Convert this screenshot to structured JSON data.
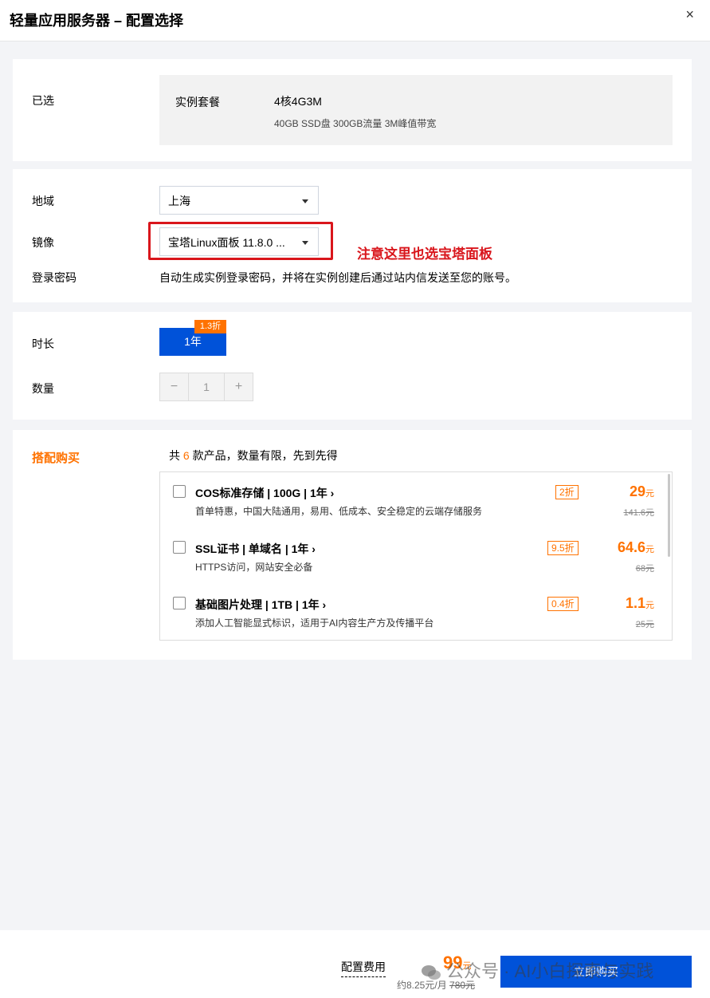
{
  "header": {
    "title": "轻量应用服务器 – 配置选择",
    "close": "×"
  },
  "selected": {
    "label": "已选",
    "key": "实例套餐",
    "value": "4核4G3M",
    "detail": "40GB SSD盘 300GB流量 3M峰值带宽"
  },
  "config": {
    "region_label": "地域",
    "region_value": "上海",
    "image_label": "镜像",
    "image_value": "宝塔Linux面板 11.8.0 ...",
    "note": "注意这里也选宝塔面板",
    "password_label": "登录密码",
    "password_text": "自动生成实例登录密码，并将在实例创建后通过站内信发送至您的账号。"
  },
  "duration": {
    "label": "时长",
    "option": "1年",
    "discount": "1.3折",
    "quantity_label": "数量",
    "quantity": "1",
    "minus": "−",
    "plus": "+"
  },
  "bundle": {
    "label": "搭配购买",
    "info_prefix": "共",
    "count": "6",
    "info_suffix": "款产品，数量有限，先到先得",
    "items": [
      {
        "name": "COS标准存储 | 100G | 1年 ›",
        "desc": "首单特惠，中国大陆通用，易用、低成本、安全稳定的云端存储服务",
        "tag": "2折",
        "price": "29",
        "unit": "元",
        "orig": "141.6元"
      },
      {
        "name": "SSL证书 | 单域名 | 1年 ›",
        "desc": "HTTPS访问，网站安全必备",
        "tag": "9.5折",
        "price": "64.6",
        "unit": "元",
        "orig": "68元"
      },
      {
        "name": "基础图片处理 | 1TB | 1年 ›",
        "desc": "添加人工智能显式标识，适用于AI内容生产方及传播平台",
        "tag": "0.4折",
        "price": "1.1",
        "unit": "元",
        "orig": "25元"
      }
    ]
  },
  "footer": {
    "fee_label": "配置费用",
    "price": "99",
    "unit": "元",
    "monthly": "约8.25元/月",
    "orig": "780元",
    "buy": "立即购买",
    "watermark": "公众号 · AI小白探索与实践"
  },
  "colors": {
    "accent": "#0052d9",
    "orange": "#ff7200",
    "red": "#d9161c"
  }
}
